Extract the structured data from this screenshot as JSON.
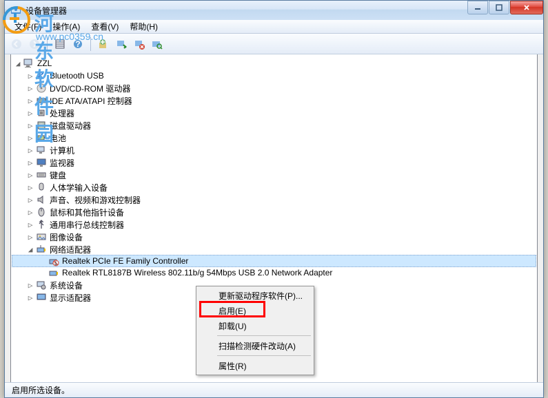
{
  "window": {
    "title": "设备管理器"
  },
  "menu": {
    "file": "文件(F)",
    "action": "操作(A)",
    "view": "查看(V)",
    "help": "帮助(H)"
  },
  "tree": {
    "root": "ZZL",
    "items": [
      {
        "label": "Bluetooth USB",
        "icon": "bluetooth",
        "exp": "▷"
      },
      {
        "label": "DVD/CD-ROM 驱动器",
        "icon": "disc",
        "exp": "▷"
      },
      {
        "label": "IDE ATA/ATAPI 控制器",
        "icon": "ide",
        "exp": "▷"
      },
      {
        "label": "处理器",
        "icon": "cpu",
        "exp": "▷"
      },
      {
        "label": "磁盘驱动器",
        "icon": "disk",
        "exp": "▷"
      },
      {
        "label": "电池",
        "icon": "battery",
        "exp": "▷"
      },
      {
        "label": "计算机",
        "icon": "computer",
        "exp": "▷"
      },
      {
        "label": "监视器",
        "icon": "monitor",
        "exp": "▷"
      },
      {
        "label": "键盘",
        "icon": "keyboard",
        "exp": "▷"
      },
      {
        "label": "人体学输入设备",
        "icon": "hid",
        "exp": "▷"
      },
      {
        "label": "声音、视频和游戏控制器",
        "icon": "sound",
        "exp": "▷"
      },
      {
        "label": "鼠标和其他指针设备",
        "icon": "mouse",
        "exp": "▷"
      },
      {
        "label": "通用串行总线控制器",
        "icon": "usb",
        "exp": "▷"
      },
      {
        "label": "图像设备",
        "icon": "image",
        "exp": "▷"
      }
    ],
    "network": {
      "label": "网络适配器",
      "exp": "◢",
      "children": [
        {
          "label": "Realtek PCIe FE Family Controller",
          "icon": "net-disabled",
          "selected": true
        },
        {
          "label": "Realtek RTL8187B Wireless 802.11b/g 54Mbps USB 2.0 Network Adapter",
          "icon": "net"
        }
      ]
    },
    "tail": [
      {
        "label": "系统设备",
        "icon": "system",
        "exp": "▷"
      },
      {
        "label": "显示适配器",
        "icon": "display",
        "exp": "▷"
      }
    ]
  },
  "context_menu": {
    "update": "更新驱动程序软件(P)...",
    "enable": "启用(E)",
    "uninstall": "卸载(U)",
    "scan": "扫描检测硬件改动(A)",
    "properties": "属性(R)"
  },
  "statusbar": "启用所选设备。",
  "watermark": {
    "text": "河东软件园",
    "url": "www.pc0359.cn"
  }
}
